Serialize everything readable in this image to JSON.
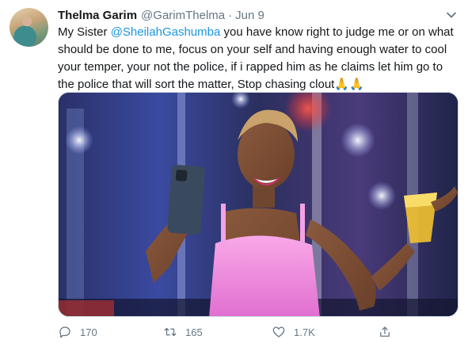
{
  "tweet": {
    "author_name": "Thelma Garim",
    "author_handle": "@GarimThelma",
    "separator": "·",
    "date": "Jun 9",
    "text_before_mention": "My Sister ",
    "mention": "@SheilahGashumba",
    "text_after_mention": " you have know right to judge me or on what should be done to me, focus on your self and having enough water to cool your temper, your not the police, if i rapped him as he claims let him go to the police that will sort the matter, Stop chasing clout",
    "emoji": "🙏🙏"
  },
  "actions": {
    "reply_count": "170",
    "retweet_count": "165",
    "like_count": "1.7K"
  },
  "icons": {
    "menu": "chevron-down-icon",
    "reply": "reply-icon",
    "retweet": "retweet-icon",
    "like": "heart-icon",
    "share": "share-icon"
  },
  "colors": {
    "link": "#1b95e0",
    "secondary_text": "#657786",
    "primary_text": "#14171a"
  }
}
